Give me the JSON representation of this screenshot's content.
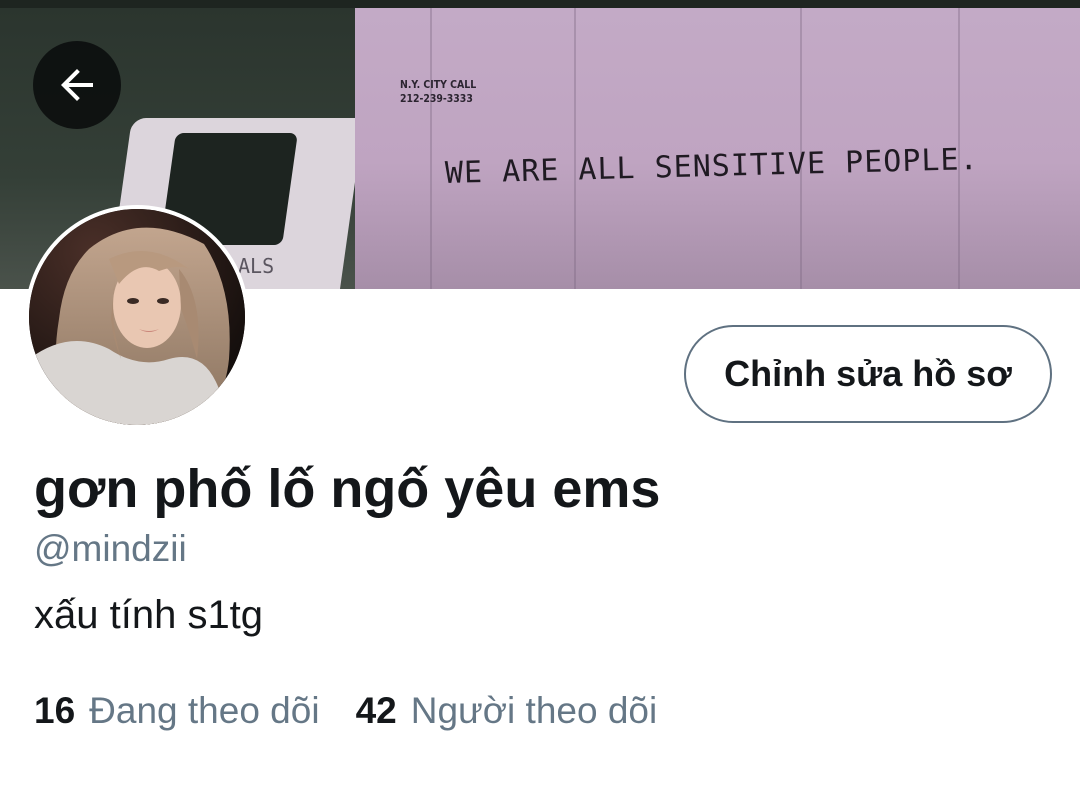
{
  "header": {
    "banner": {
      "phone_label_line1": "N.Y. CITY CALL",
      "phone_label_line2": "212-239-3333",
      "graffiti_text": "WE ARE ALL SENSITIVE PEOPLE.",
      "truck_side_text": "ALS"
    },
    "back_icon": "arrow-left-icon"
  },
  "profile": {
    "display_name": "gơn phố lố ngố yêu ems",
    "handle": "@mindzii",
    "bio": "xấu tính s1tg",
    "edit_button_label": "Chỉnh sửa hồ sơ",
    "following_count": "16",
    "following_label": "Đang theo dõi",
    "followers_count": "42",
    "followers_label": "Người theo dõi"
  },
  "colors": {
    "primary_text": "#14171a",
    "secondary_text": "#657786",
    "button_border": "#5f7181",
    "background": "#ffffff"
  }
}
